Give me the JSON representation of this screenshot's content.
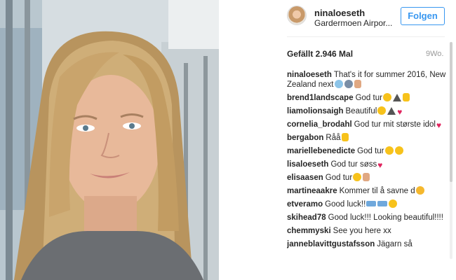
{
  "post": {
    "username": "ninaloeseth",
    "location": "Gardermoen Airpor...",
    "follow_label": "Folgen",
    "likes": "Gefällt 2.946 Mal",
    "age": "9Wo."
  },
  "comments": [
    {
      "user": "ninaloeseth",
      "text": "That's it for summer 2016, New Zealand next",
      "emojis": [
        "snow",
        "face",
        "hand"
      ]
    },
    {
      "user": "brend1landscape",
      "text": "God tur",
      "emojis": [
        "yellow",
        "mountain",
        "thumb"
      ]
    },
    {
      "user": "liamolionsaigh",
      "text": "Beautiful",
      "emojis": [
        "yellow",
        "mountain",
        "heart"
      ]
    },
    {
      "user": "cornelia_brodahl",
      "text": "God tur mit største idol",
      "emojis": [
        "heart"
      ]
    },
    {
      "user": "bergabon",
      "text": "Råå",
      "emojis": [
        "thumb"
      ]
    },
    {
      "user": "mariellebenedicte",
      "text": "God tur",
      "emojis": [
        "yellow",
        "yellow"
      ]
    },
    {
      "user": "lisaloeseth",
      "text": "God tur søss",
      "emojis": [
        "heart"
      ]
    },
    {
      "user": "elisaasen",
      "text": "God tur",
      "emojis": [
        "yellow",
        "hand"
      ]
    },
    {
      "user": "martineaakre",
      "text": "Kommer til å savne d",
      "emojis": [
        "sad"
      ]
    },
    {
      "user": "etveramo",
      "text": "Good luck!!",
      "emojis": [
        "ski",
        "ski",
        "yellow"
      ]
    },
    {
      "user": "skihead78",
      "text": "Good luck!!! Looking beautiful!!!!",
      "emojis": []
    },
    {
      "user": "chemmyski",
      "text": "See you here xx",
      "emojis": []
    },
    {
      "user": "janneblavittgustafsson",
      "text": "Jägarn så",
      "emojis": []
    }
  ]
}
